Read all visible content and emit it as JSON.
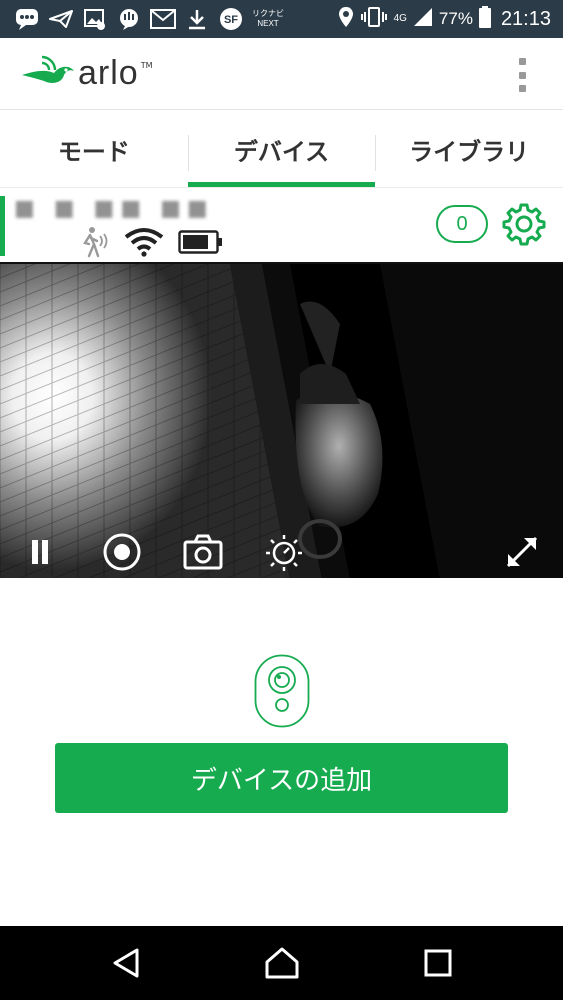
{
  "status_bar": {
    "notification_icons": [
      "chat-icon",
      "paper-plane-icon",
      "gallery-icon",
      "message-icon",
      "gmail-icon",
      "download-icon",
      "sf-icon",
      "rikunabi-next-icon"
    ],
    "rikunabi_label_top": "リクナビ",
    "rikunabi_label_bottom": "NEXT",
    "sf_label": "SF",
    "network_label": "4G",
    "battery_percent": "77%",
    "time": "21:13"
  },
  "app_bar": {
    "logo_text": "arlo",
    "logo_tm": "TM"
  },
  "tabs": [
    {
      "label": "モード",
      "active": false
    },
    {
      "label": "デバイス",
      "active": true
    },
    {
      "label": "ライブラリ",
      "active": false
    }
  ],
  "device": {
    "name": "■ ■ ■■ ■■",
    "status_icons": [
      "motion-icon",
      "wifi-icon",
      "battery-icon"
    ],
    "notification_count": "0"
  },
  "feed_controls": [
    "pause-icon",
    "record-icon",
    "snapshot-icon",
    "night-vision-icon",
    "fullscreen-icon"
  ],
  "add_device_button": "デバイスの追加",
  "colors": {
    "accent": "#16ab4f",
    "status_bar": "#2b3b47",
    "nav_bar": "#000000"
  }
}
